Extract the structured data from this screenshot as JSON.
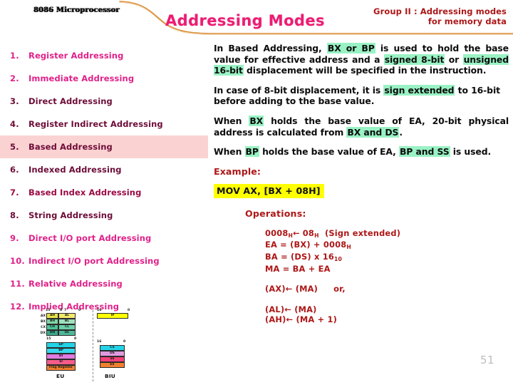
{
  "header": {
    "brand": "8086 Microprocessor",
    "title": "Addressing Modes",
    "group_line1": "Group II : Addressing modes",
    "group_line2": "for memory data",
    "swoosh_color": "#d98b33",
    "title_color": "#ec1d73",
    "group_color": "#ae1717"
  },
  "modes": [
    {
      "num": "1.",
      "label": "Register Addressing",
      "tone": "pink",
      "highlight": false
    },
    {
      "num": "2.",
      "label": "Immediate Addressing",
      "tone": "pink",
      "highlight": false
    },
    {
      "num": "3.",
      "label": "Direct Addressing",
      "tone": "dark",
      "highlight": false
    },
    {
      "num": "4.",
      "label": "Register Indirect Addressing",
      "tone": "dark",
      "highlight": false
    },
    {
      "num": "5.",
      "label": "Based Addressing",
      "tone": "dark",
      "highlight": true
    },
    {
      "num": "6.",
      "label": "Indexed Addressing",
      "tone": "dark",
      "highlight": false
    },
    {
      "num": "7.",
      "label": "Based Index Addressing",
      "tone": "crim",
      "highlight": false
    },
    {
      "num": "8.",
      "label": "String Addressing",
      "tone": "dark",
      "highlight": false
    },
    {
      "num": "9.",
      "label": "Direct I/O port Addressing",
      "tone": "pink",
      "highlight": false
    },
    {
      "num": "10.",
      "label": "Indirect I/O port Addressing",
      "tone": "pink",
      "highlight": false
    },
    {
      "num": "11.",
      "label": "Relative Addressing",
      "tone": "pink",
      "highlight": false
    },
    {
      "num": "12.",
      "label": "Implied Addressing",
      "tone": "pink",
      "highlight": false
    }
  ],
  "highlight_row_color": "#fbd2d2",
  "content": {
    "p1": {
      "s1": "In Based Addressing, ",
      "hl1": "BX or BP",
      "s2": " is used to hold the base value for effective address and a ",
      "hl2": "signed 8-bit",
      "s3": " or ",
      "hl3": "unsigned 16-bit",
      "s4": " displacement will be specified in the instruction."
    },
    "p2": {
      "s1": "In case of 8-bit displacement, it is ",
      "hl1": "sign extended",
      "s2": " to 16-bit before adding to the base value."
    },
    "p3": {
      "s1": "When ",
      "hl1": "BX",
      "s2": " holds the base value of EA, 20-bit physical address is calculated from ",
      "hl2": "BX and DS",
      "s3": "."
    },
    "p4": {
      "s1": "When ",
      "hl1": "BP",
      "s2": " holds the base value of EA, ",
      "hl2": "BP and SS",
      "s3": " is used."
    },
    "example_head": "Example:",
    "example_code": "MOV AX, [BX + 08H]",
    "operations_head": "Operations:",
    "operations": {
      "line1_a": "0008",
      "line1_sub_a": "H",
      "line1_arrow": "←",
      "line1_b": "08",
      "line1_sub_b": "H",
      "line1_note": "(Sign extended)",
      "line2_a": "EA = (BX) + 0008",
      "line2_sub": "H",
      "line3_a": "BA = (DS) x 16",
      "line3_sub": "10",
      "line4": "MA = BA + EA",
      "line5": "(AX)← (MA)",
      "line5_or": "or,",
      "line6": "(AL)← (MA)",
      "line7": "(AH)← (MA + 1)"
    },
    "highlight_green": "#99f2c4",
    "highlight_yellow": "#ffff00"
  },
  "page_number": "51",
  "diagram": {
    "eu_label": "EU",
    "biu_label": "BIU",
    "eu_top": {
      "scale_left": "15",
      "scale_mid_hi": "8",
      "scale_mid_lo": "7",
      "scale_right": "0",
      "rows": [
        {
          "side": "AX",
          "hi": "AH",
          "lo": "AL",
          "hi_color": "#e8e14a",
          "lo_color": "#f2e96b"
        },
        {
          "side": "BX",
          "hi": "BH",
          "lo": "BL",
          "hi_color": "#7fd6a6",
          "lo_color": "#9fe0bb"
        },
        {
          "side": "CX",
          "hi": "CH",
          "lo": "CL",
          "hi_color": "#4fc49a",
          "lo_color": "#6cd0a9"
        },
        {
          "side": "DX",
          "hi": "DH",
          "lo": "DL",
          "hi_color": "#3aa98c",
          "lo_color": "#4fb89a"
        }
      ]
    },
    "eu_bottom": {
      "scale_left": "15",
      "scale_right": "0",
      "rows": [
        {
          "name": "SP",
          "color": "#22d4e8"
        },
        {
          "name": "BP",
          "color": "#36d9ee"
        },
        {
          "name": "DI",
          "color": "#e07ae0"
        },
        {
          "name": "SI",
          "color": "#f45c8a"
        },
        {
          "name": "Flag Register",
          "color": "#f08030"
        }
      ]
    },
    "biu_top": {
      "scale_left": "16",
      "scale_right": "0",
      "rows": [
        {
          "name": "IP",
          "color": "#ffff00"
        }
      ]
    },
    "biu_bottom": {
      "scale_left": "16",
      "scale_right": "0",
      "rows": [
        {
          "name": "CS",
          "color": "#22d4e8"
        },
        {
          "name": "DS",
          "color": "#e09ade"
        },
        {
          "name": "SS",
          "color": "#f4407a"
        },
        {
          "name": "ES",
          "color": "#f08030"
        }
      ]
    }
  }
}
